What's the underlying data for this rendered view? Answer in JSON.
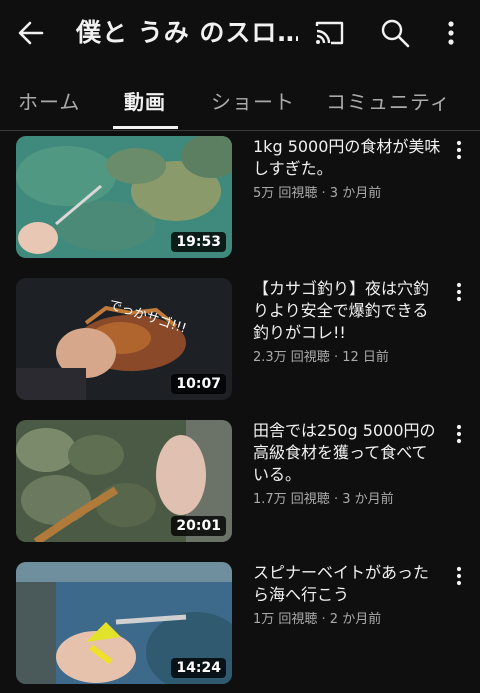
{
  "header": {
    "title": "僕と うみ のスロ…",
    "icons": [
      "back-arrow-icon",
      "cast-icon",
      "search-icon",
      "more-vert-icon"
    ]
  },
  "tabs": [
    {
      "label": "ホーム",
      "active": false
    },
    {
      "label": "動画",
      "active": true
    },
    {
      "label": "ショート",
      "active": false
    },
    {
      "label": "コミュニティ",
      "active": false
    }
  ],
  "videos": [
    {
      "title": "1kg 5000円の食材が美味しすぎた。",
      "meta": "5万 回視聴 · 3 か月前",
      "duration": "19:53"
    },
    {
      "title": "【カサゴ釣り】夜は穴釣りより安全で爆釣できる釣りがコレ!!",
      "meta": "2.3万 回視聴 · 12 日前",
      "duration": "10:07",
      "overlay_text": "でっかサゴ!!!"
    },
    {
      "title": "田舎では250g 5000円の高級食材を獲って食べている。",
      "meta": "1.7万 回視聴 · 3 か月前",
      "duration": "20:01"
    },
    {
      "title": "スピナーベイトがあったら海へ行こう",
      "meta": "1万 回視聴 · 2 か月前",
      "duration": "14:24"
    }
  ]
}
